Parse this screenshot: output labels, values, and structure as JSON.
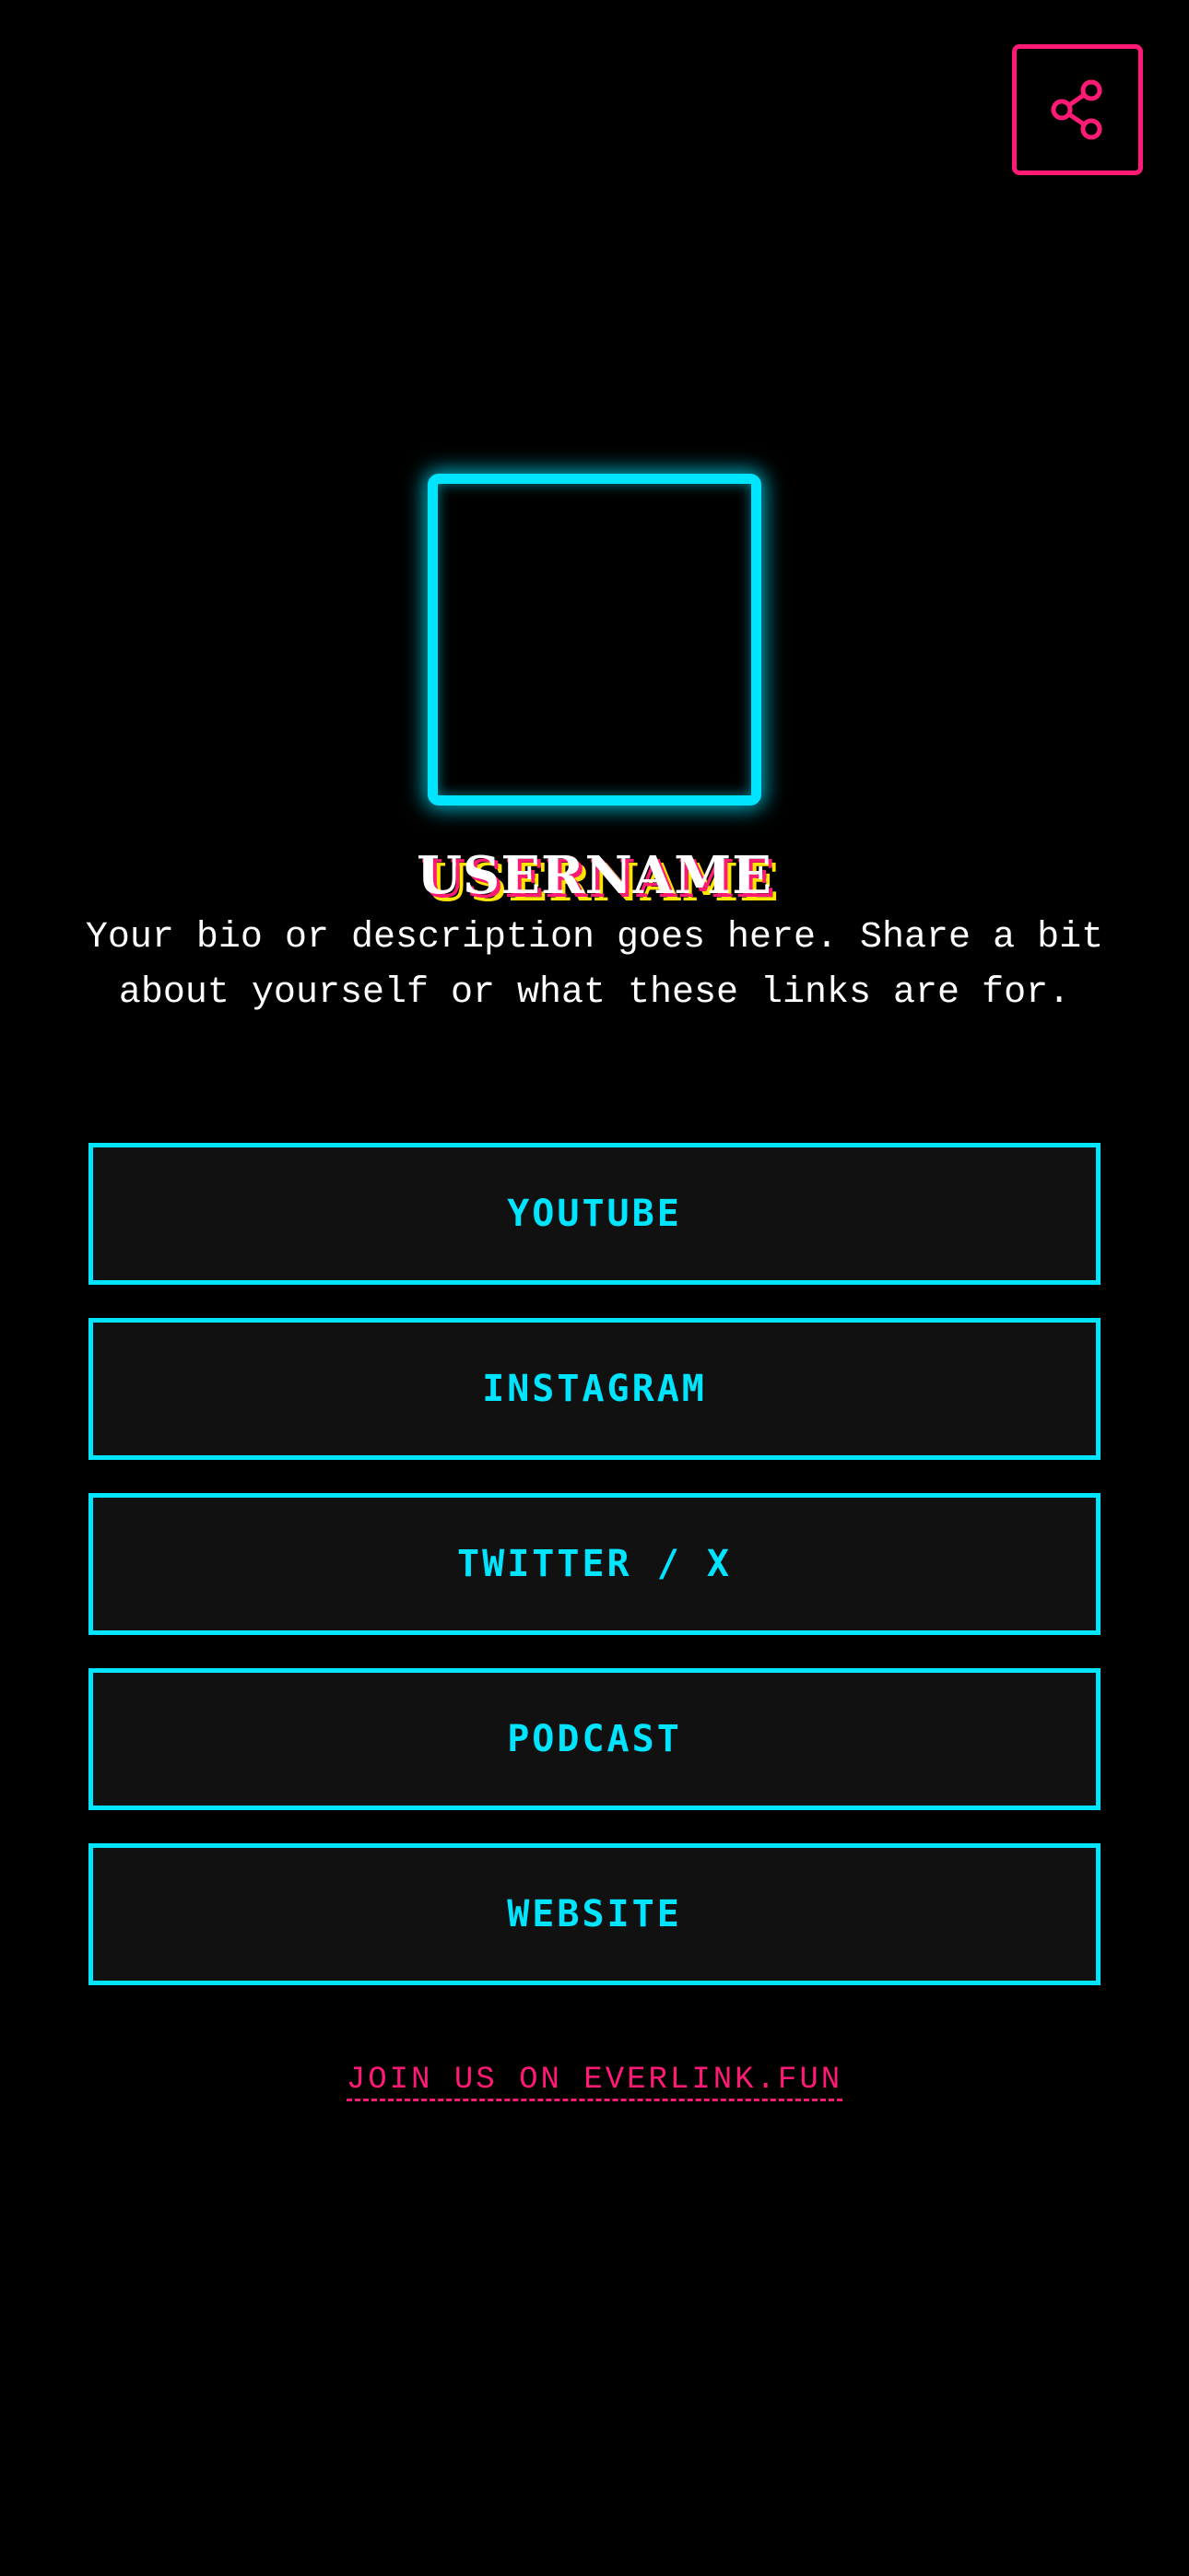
{
  "share": {
    "icon": "share-icon",
    "color": "#ff1a75"
  },
  "profile": {
    "username": "USERNAME",
    "bio": "Your bio or description goes here. Share a bit about yourself or what these links are for."
  },
  "links": [
    {
      "label": "YOUTUBE"
    },
    {
      "label": "INSTAGRAM"
    },
    {
      "label": "TWITTER / X"
    },
    {
      "label": "PODCAST"
    },
    {
      "label": "WEBSITE"
    }
  ],
  "footer": {
    "label": "JOIN US ON EVERLINK.FUN"
  },
  "colors": {
    "background": "#000000",
    "accent_cyan": "#00e5ff",
    "accent_pink": "#ff1a75",
    "accent_yellow": "#ffe600",
    "button_fill": "#111111"
  }
}
